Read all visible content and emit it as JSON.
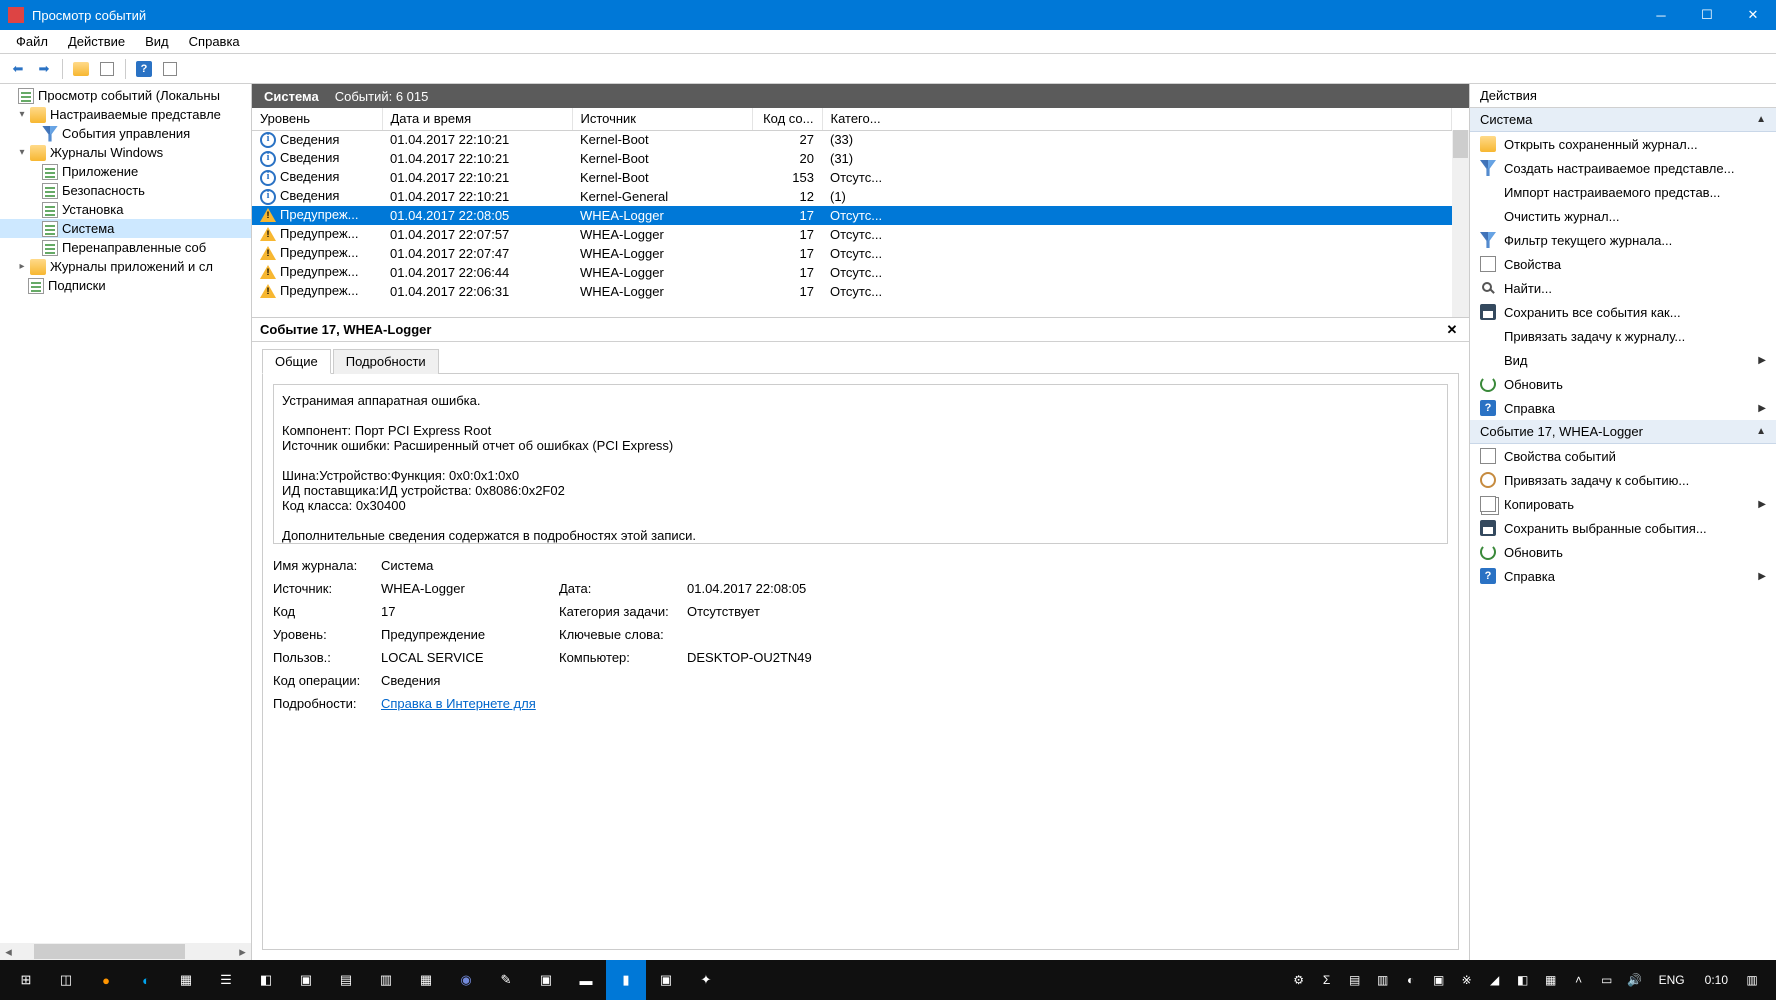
{
  "window": {
    "title": "Просмотр событий"
  },
  "menubar": {
    "items": [
      "Файл",
      "Действие",
      "Вид",
      "Справка"
    ]
  },
  "tree": {
    "root": "Просмотр событий (Локальны",
    "custom_views": "Настраиваемые представле",
    "admin_events": "События управления",
    "win_logs": "Журналы Windows",
    "app": "Приложение",
    "security": "Безопасность",
    "setup": "Установка",
    "system": "Система",
    "forwarded": "Перенаправленные соб",
    "app_services": "Журналы приложений и сл",
    "subscriptions": "Подписки"
  },
  "center": {
    "header_title": "Система",
    "header_count": "Событий: 6 015",
    "columns": {
      "level": "Уровень",
      "datetime": "Дата и время",
      "source": "Источник",
      "code": "Код со...",
      "category": "Катего..."
    },
    "rows": [
      {
        "icon": "info",
        "level": "Сведения",
        "datetime": "01.04.2017 22:10:21",
        "source": "Kernel-Boot",
        "code": "27",
        "category": "(33)",
        "sel": false
      },
      {
        "icon": "info",
        "level": "Сведения",
        "datetime": "01.04.2017 22:10:21",
        "source": "Kernel-Boot",
        "code": "20",
        "category": "(31)",
        "sel": false
      },
      {
        "icon": "info",
        "level": "Сведения",
        "datetime": "01.04.2017 22:10:21",
        "source": "Kernel-Boot",
        "code": "153",
        "category": "Отсутс...",
        "sel": false
      },
      {
        "icon": "info",
        "level": "Сведения",
        "datetime": "01.04.2017 22:10:21",
        "source": "Kernel-General",
        "code": "12",
        "category": "(1)",
        "sel": false
      },
      {
        "icon": "warn",
        "level": "Предупреж...",
        "datetime": "01.04.2017 22:08:05",
        "source": "WHEA-Logger",
        "code": "17",
        "category": "Отсутс...",
        "sel": true
      },
      {
        "icon": "warn",
        "level": "Предупреж...",
        "datetime": "01.04.2017 22:07:57",
        "source": "WHEA-Logger",
        "code": "17",
        "category": "Отсутс...",
        "sel": false
      },
      {
        "icon": "warn",
        "level": "Предупреж...",
        "datetime": "01.04.2017 22:07:47",
        "source": "WHEA-Logger",
        "code": "17",
        "category": "Отсутс...",
        "sel": false
      },
      {
        "icon": "warn",
        "level": "Предупреж...",
        "datetime": "01.04.2017 22:06:44",
        "source": "WHEA-Logger",
        "code": "17",
        "category": "Отсутс...",
        "sel": false
      },
      {
        "icon": "warn",
        "level": "Предупреж...",
        "datetime": "01.04.2017 22:06:31",
        "source": "WHEA-Logger",
        "code": "17",
        "category": "Отсутс...",
        "sel": false
      }
    ]
  },
  "detail": {
    "header": "Событие 17, WHEA-Logger",
    "tab_general": "Общие",
    "tab_details": "Подробности",
    "description": "Устранимая аппаратная ошибка.\n\nКомпонент: Порт PCI Express Root\nИсточник ошибки: Расширенный отчет об ошибках (PCI Express)\n\nШина:Устройство:Функция: 0x0:0x1:0x0\nИД поставщика:ИД устройства: 0x8086:0x2F02\nКод класса: 0x30400\n\nДополнительные сведения содержатся в подробностях этой записи.",
    "labels": {
      "log_name": "Имя журнала:",
      "source": "Источник:",
      "code": "Код",
      "level": "Уровень:",
      "user": "Пользов.:",
      "opcode": "Код операции:",
      "moreinfo": "Подробности:",
      "date": "Дата:",
      "task_cat": "Категория задачи:",
      "keywords": "Ключевые слова:",
      "computer": "Компьютер:"
    },
    "values": {
      "log_name": "Система",
      "source": "WHEA-Logger",
      "code": "17",
      "level": "Предупреждение",
      "user": "LOCAL SERVICE",
      "opcode": "Сведения",
      "date": "01.04.2017 22:08:05",
      "task_cat": "Отсутствует",
      "keywords": "",
      "computer": "DESKTOP-OU2TN49",
      "link": "Справка в Интернете для "
    }
  },
  "actions": {
    "title": "Действия",
    "section1": "Система",
    "items1": [
      {
        "icon": "open",
        "label": "Открыть сохраненный журнал..."
      },
      {
        "icon": "filter",
        "label": "Создать настраиваемое представле..."
      },
      {
        "icon": "",
        "label": "Импорт настраиваемого представ..."
      },
      {
        "icon": "",
        "label": "Очистить журнал..."
      },
      {
        "icon": "filter",
        "label": "Фильтр текущего журнала..."
      },
      {
        "icon": "prop",
        "label": "Свойства"
      },
      {
        "icon": "find",
        "label": "Найти..."
      },
      {
        "icon": "save",
        "label": "Сохранить все события как..."
      },
      {
        "icon": "",
        "label": "Привязать задачу к журналу..."
      },
      {
        "icon": "",
        "label": "Вид",
        "expand": true
      },
      {
        "icon": "refresh",
        "label": "Обновить"
      },
      {
        "icon": "help",
        "label": "Справка",
        "expand": true
      }
    ],
    "section2": "Событие 17, WHEA-Logger",
    "items2": [
      {
        "icon": "prop",
        "label": "Свойства событий"
      },
      {
        "icon": "clock",
        "label": "Привязать задачу к событию..."
      },
      {
        "icon": "copy",
        "label": "Копировать",
        "expand": true
      },
      {
        "icon": "save",
        "label": "Сохранить выбранные события..."
      },
      {
        "icon": "refresh",
        "label": "Обновить"
      },
      {
        "icon": "help",
        "label": "Справка",
        "expand": true
      }
    ]
  },
  "taskbar": {
    "lang": "ENG",
    "time": "0:10"
  }
}
